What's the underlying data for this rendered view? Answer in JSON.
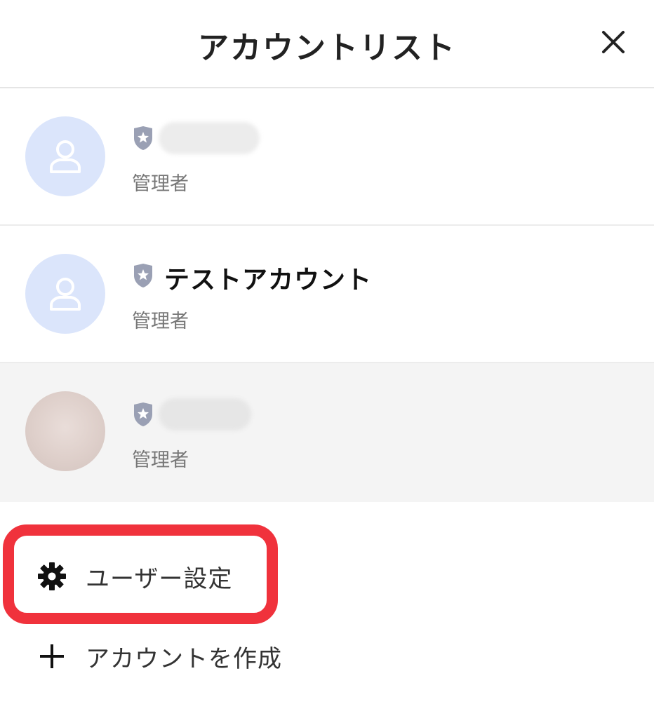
{
  "header": {
    "title": "アカウントリスト"
  },
  "accounts": [
    {
      "name": "",
      "role": "管理者",
      "avatar": "default-user-icon",
      "selected": false
    },
    {
      "name": "テストアカウント",
      "role": "管理者",
      "avatar": "default-user-icon",
      "selected": false
    },
    {
      "name": "",
      "role": "管理者",
      "avatar": "photo",
      "selected": true
    }
  ],
  "actions": {
    "user_settings_label": "ユーザー設定",
    "create_account_label": "アカウントを作成"
  },
  "colors": {
    "highlight": "#f0323c",
    "avatar_bg": "#dbe5fb",
    "badge": "#9aa0b4",
    "selected_row": "#f4f4f4"
  }
}
